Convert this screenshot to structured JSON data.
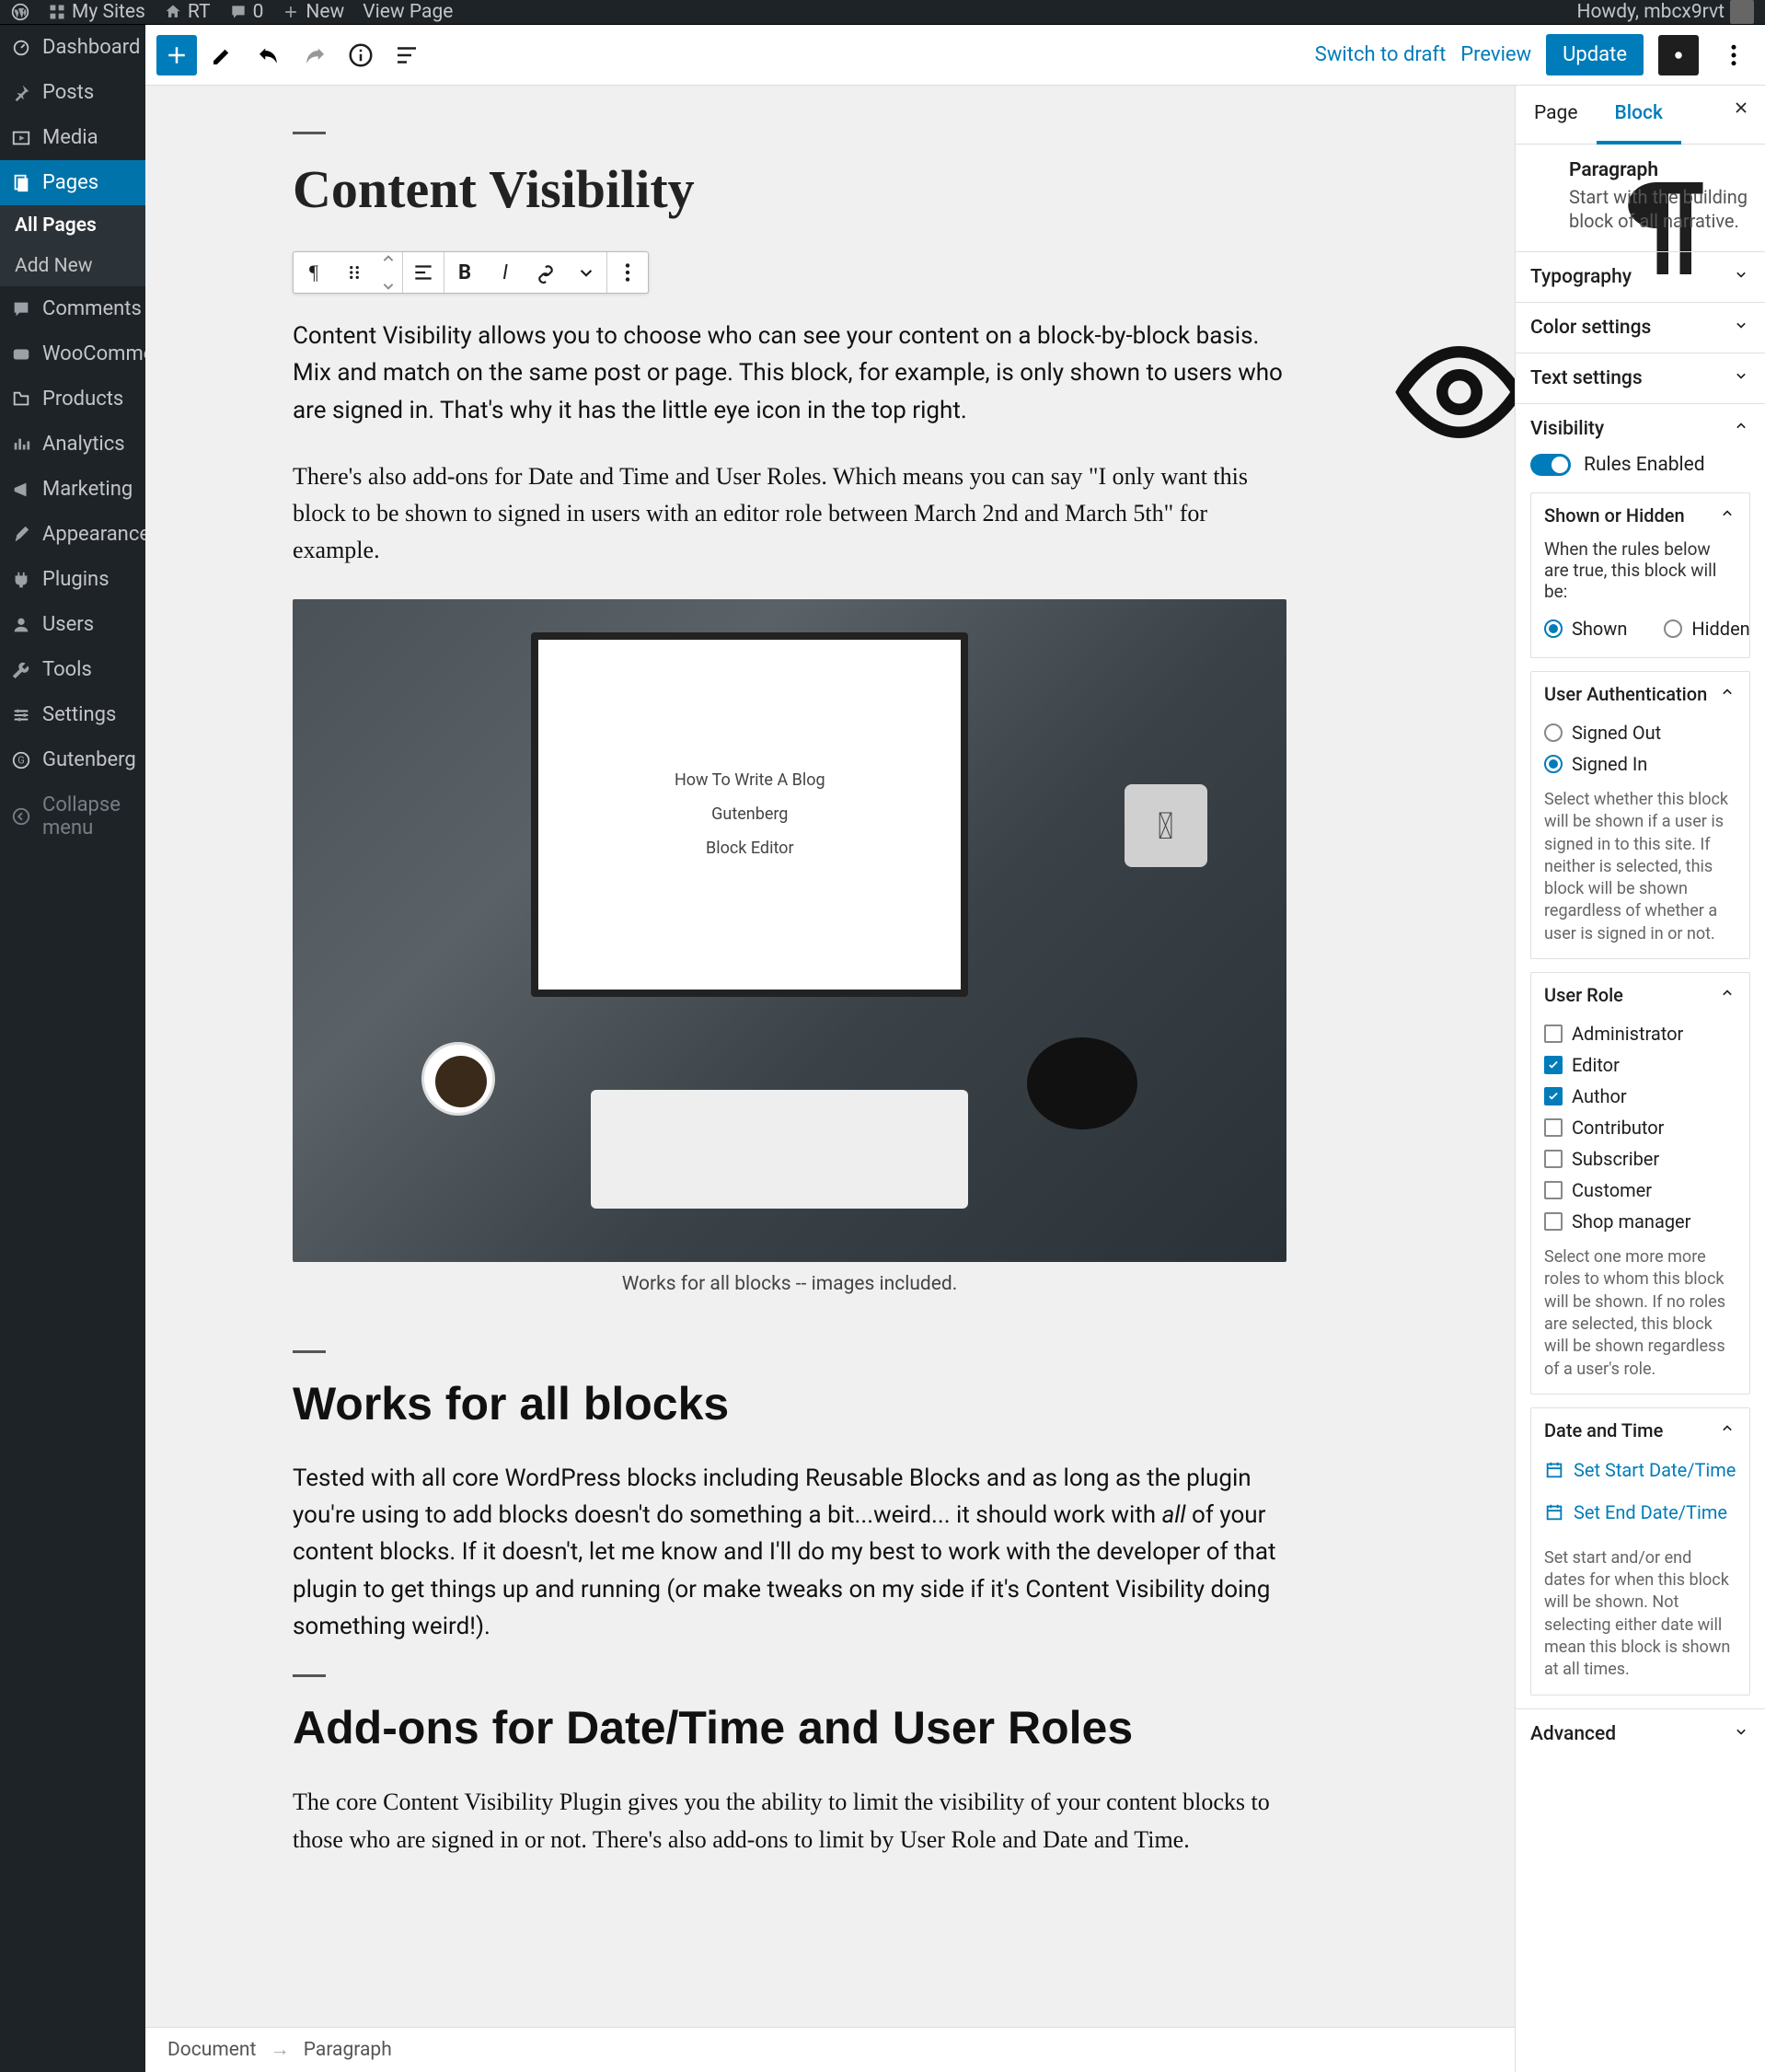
{
  "adminBar": {
    "mySites": "My Sites",
    "siteName": "RT",
    "comments": "0",
    "newItem": "New",
    "viewPage": "View Page",
    "howdy": "Howdy, mbcx9rvt"
  },
  "sideMenu": {
    "items": [
      {
        "label": "Dashboard",
        "icon": "dashboard"
      },
      {
        "label": "Posts",
        "icon": "pin"
      },
      {
        "label": "Media",
        "icon": "media"
      },
      {
        "label": "Pages",
        "icon": "pages",
        "active": true
      },
      {
        "label": "Comments",
        "icon": "comments"
      },
      {
        "label": "WooCommerce",
        "icon": "woo"
      },
      {
        "label": "Products",
        "icon": "products"
      },
      {
        "label": "Analytics",
        "icon": "analytics"
      },
      {
        "label": "Marketing",
        "icon": "marketing"
      },
      {
        "label": "Appearance",
        "icon": "appearance"
      },
      {
        "label": "Plugins",
        "icon": "plugins"
      },
      {
        "label": "Users",
        "icon": "users"
      },
      {
        "label": "Tools",
        "icon": "tools"
      },
      {
        "label": "Settings",
        "icon": "settings"
      },
      {
        "label": "Gutenberg",
        "icon": "gutenberg"
      }
    ],
    "pagesSub": [
      {
        "label": "All Pages",
        "cur": true
      },
      {
        "label": "Add New",
        "cur": false
      }
    ],
    "collapse": "Collapse menu"
  },
  "editorHeader": {
    "switchDraft": "Switch to draft",
    "preview": "Preview",
    "update": "Update"
  },
  "content": {
    "title": "Content Visibility",
    "para1": "Content Visibility allows you to choose who can see your content on a block-by-block basis. Mix and match on the same post or page. This block, for example, is only shown to users who are signed in. That's why it has the little eye icon in the top right.",
    "para2": "There's also add-ons for Date and Time and User Roles. Which means you can say \"I only want this block to be shown to signed in users with an editor role between March 2nd and March 5th\" for example.",
    "imgCaption": "Works for all blocks -- images included.",
    "imgInner": {
      "t1": "How To Write A Blog",
      "t2": "Gutenberg",
      "t3": "Block Editor"
    },
    "h2a": "Works for all blocks",
    "para3a": "Tested with all core WordPress blocks including Reusable Blocks and as long as the plugin you're using to add blocks doesn't do something a bit...weird... it should work with ",
    "para3i": "all",
    "para3b": " of your content blocks. If it doesn't, let me know and I'll do my best to work with the developer of that plugin to get things up and running (or make tweaks on my side if it's Content Visibility doing something weird!).",
    "h2b": "Add-ons for Date/Time and User Roles",
    "para4": "The core Content Visibility Plugin gives you the ability to limit the visibility of your content blocks to those who are signed in or not. There's also add-ons to limit by User Role and Date and Time."
  },
  "settings": {
    "tabs": {
      "page": "Page",
      "block": "Block"
    },
    "block": {
      "name": "Paragraph",
      "desc": "Start with the building block of all narrative."
    },
    "sections": {
      "typography": "Typography",
      "color": "Color settings",
      "text": "Text settings",
      "visibility": "Visibility",
      "advanced": "Advanced"
    },
    "rulesEnabled": "Rules Enabled",
    "shownHidden": {
      "title": "Shown or Hidden",
      "intro": "When the rules below are true, this block will be:",
      "shown": "Shown",
      "hidden": "Hidden"
    },
    "userAuth": {
      "title": "User Authentication",
      "signedOut": "Signed Out",
      "signedIn": "Signed In",
      "help": "Select whether this block will be shown if a user is signed in to this site. If neither is selected, this block will be shown regardless of whether a user is signed in or not."
    },
    "userRole": {
      "title": "User Role",
      "roles": [
        {
          "label": "Administrator",
          "on": false
        },
        {
          "label": "Editor",
          "on": true
        },
        {
          "label": "Author",
          "on": true
        },
        {
          "label": "Contributor",
          "on": false
        },
        {
          "label": "Subscriber",
          "on": false
        },
        {
          "label": "Customer",
          "on": false
        },
        {
          "label": "Shop manager",
          "on": false
        }
      ],
      "help": "Select one more more roles to whom this block will be shown. If no roles are selected, this block will be shown regardless of a user's role."
    },
    "dateTime": {
      "title": "Date and Time",
      "setStart": "Set Start Date/Time",
      "setEnd": "Set End Date/Time",
      "help": "Set start and/or end dates for when this block will be shown. Not selecting either date will mean this block is shown at all times."
    }
  },
  "breadcrumb": {
    "document": "Document",
    "paragraph": "Paragraph"
  }
}
